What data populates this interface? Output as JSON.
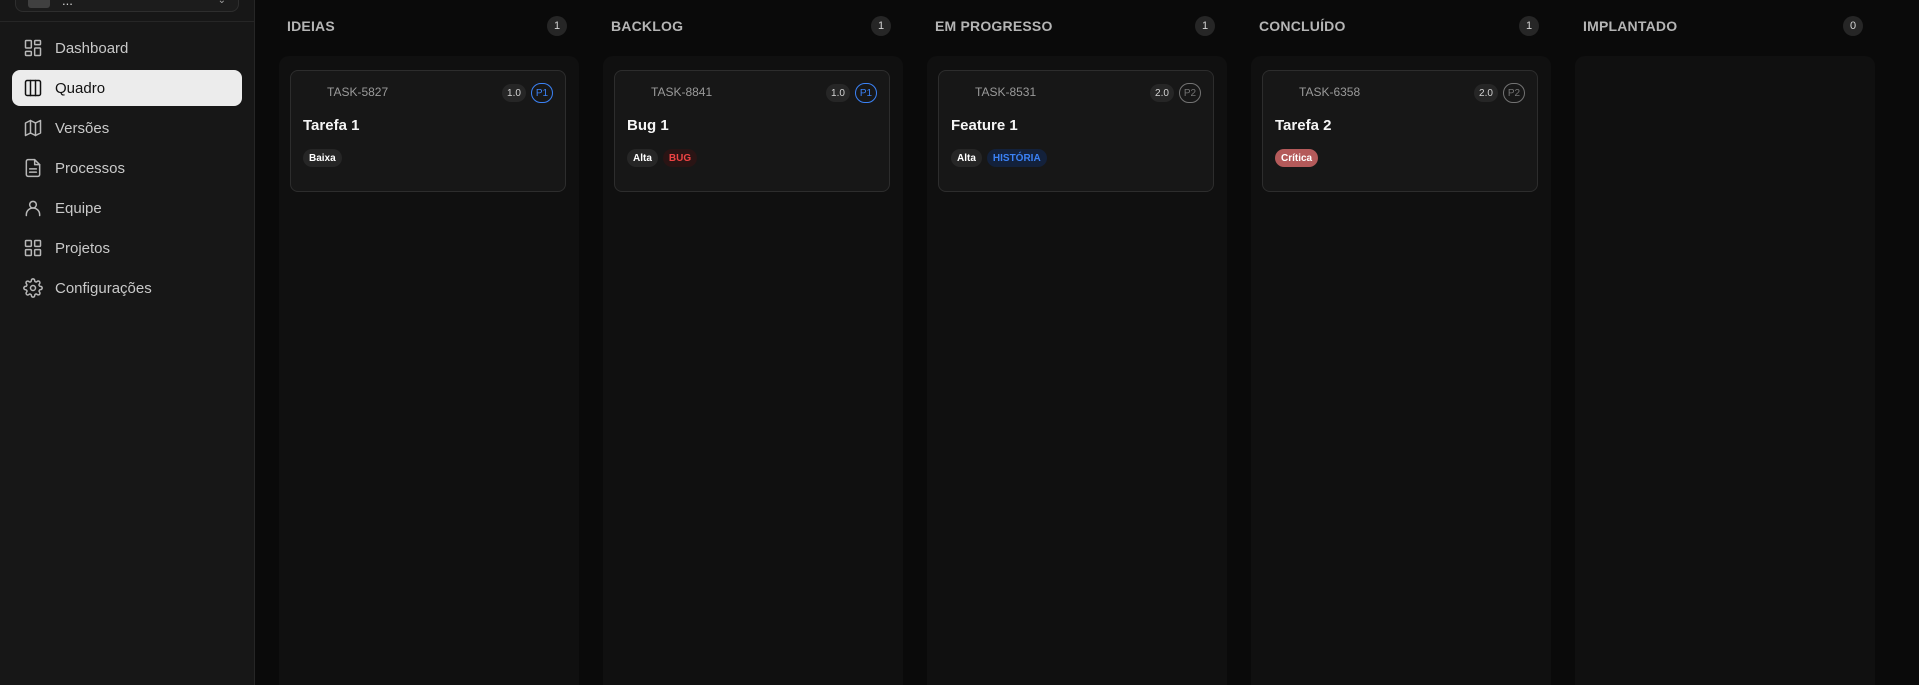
{
  "sidebar": {
    "project": {
      "name": "..."
    },
    "items": [
      {
        "label": "Dashboard",
        "icon": "dashboard-icon",
        "active": false
      },
      {
        "label": "Quadro",
        "icon": "board-icon",
        "active": true
      },
      {
        "label": "Versões",
        "icon": "map-icon",
        "active": false
      },
      {
        "label": "Processos",
        "icon": "document-icon",
        "active": false
      },
      {
        "label": "Equipe",
        "icon": "user-icon",
        "active": false
      },
      {
        "label": "Projetos",
        "icon": "grid-icon",
        "active": false
      },
      {
        "label": "Configurações",
        "icon": "gear-icon",
        "active": false
      }
    ]
  },
  "board": {
    "columns": [
      {
        "title": "IDEIAS",
        "count": "1",
        "cards": [
          {
            "id": "TASK-5827",
            "version": "1.0",
            "priority": "P1",
            "title": "Tarefa 1",
            "tags": [
              {
                "label": "Baixa",
                "kind": "neutral"
              }
            ]
          }
        ]
      },
      {
        "title": "BACKLOG",
        "count": "1",
        "cards": [
          {
            "id": "TASK-8841",
            "version": "1.0",
            "priority": "P1",
            "title": "Bug 1",
            "tags": [
              {
                "label": "Alta",
                "kind": "neutral"
              },
              {
                "label": "BUG",
                "kind": "bug"
              }
            ]
          }
        ]
      },
      {
        "title": "EM PROGRESSO",
        "count": "1",
        "cards": [
          {
            "id": "TASK-8531",
            "version": "2.0",
            "priority": "P2",
            "title": "Feature 1",
            "tags": [
              {
                "label": "Alta",
                "kind": "neutral"
              },
              {
                "label": "HISTÓRIA",
                "kind": "story"
              }
            ]
          }
        ]
      },
      {
        "title": "CONCLUÍDO",
        "count": "1",
        "cards": [
          {
            "id": "TASK-6358",
            "version": "2.0",
            "priority": "P2",
            "title": "Tarefa 2",
            "tags": [
              {
                "label": "Crítica",
                "kind": "critical"
              }
            ]
          }
        ]
      },
      {
        "title": "IMPLANTADO",
        "count": "0",
        "cards": []
      }
    ]
  },
  "colors": {
    "p1": "#3b82f6",
    "p2": "#737373",
    "bug_text": "#ef4444",
    "bug_bg": "#2a1414",
    "story_text": "#3b82f6",
    "story_bg": "#13213b",
    "critical_bg": "#b45a5a",
    "neutral_bg": "#262626"
  }
}
